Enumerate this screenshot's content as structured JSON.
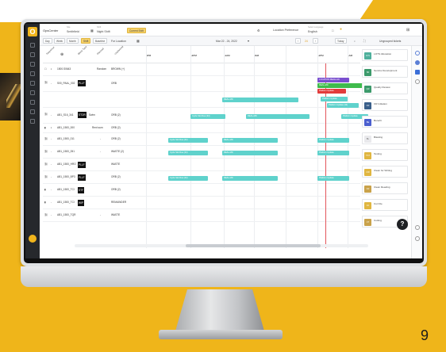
{
  "page_number": "9",
  "app": {
    "logo_letter": "O",
    "title": "OpsCenter",
    "selectors": [
      {
        "label": "Site",
        "value": "Smithfield"
      },
      {
        "label": "Shift",
        "value": "Night Shift"
      }
    ],
    "current_shift_button": "Current Shift",
    "location_preference": "Location Preference",
    "language_label": "Select Language",
    "language_value": "English"
  },
  "toolbar": {
    "view_buttons": [
      "Day",
      "Week",
      "Month",
      "Shift",
      "Baseline"
    ],
    "active_view": "Shift",
    "for_location": "For Location",
    "date_range": "Mar 22 - 24, 2022",
    "zoom": "24",
    "today_button": "Today",
    "ungrouped": "Ungrouped tickets"
  },
  "grid": {
    "column_titles": [
      "Sequence",
      "Block Type",
      "Planned",
      "Unplanned"
    ],
    "time_labels": [
      "9PM",
      "12PM",
      "11AM",
      "3AM",
      "11PM",
      "1AM"
    ],
    "rows": [
      {
        "id": "1500.S0643",
        "tag": "",
        "type": "Random",
        "value": "BROWN (+)"
      },
      {
        "id": "S00_PAAL_002",
        "tag": "PLLF",
        "type": "",
        "value": "ORB"
      },
      {
        "id": "",
        "tag": "",
        "type": "",
        "value": ""
      },
      {
        "id": "AB1_S16_341",
        "tag": "STOR",
        "type": "Swim",
        "value": "ORB (2)"
      },
      {
        "id": "AB1_1500_000",
        "tag": "",
        "type": "Rent sum",
        "value": "ORB (2)"
      },
      {
        "id": "AB1_1500_011",
        "tag": "",
        "type": "-",
        "value": "ORB (2)"
      },
      {
        "id": "AB1_1500_051",
        "tag": "",
        "type": "-",
        "value": "WASTE (2)"
      },
      {
        "id": "AB1_1500_HRO",
        "tag": "PLLF",
        "type": "",
        "value": "WASTE"
      },
      {
        "id": "AB1_1500_BP3",
        "tag": "PLLF",
        "type": "",
        "value": "ORB (2)"
      },
      {
        "id": "AB1_1500_TCI",
        "tag": "STF",
        "type": "",
        "value": "ORB (2)"
      },
      {
        "id": "AB1_1500_TCI",
        "tag": "WIP",
        "type": "",
        "value": "REMAINDER"
      },
      {
        "id": "AB1_1500_TQR",
        "tag": "",
        "type": "-",
        "value": "WASTE"
      }
    ],
    "bars": [
      {
        "label": "LOCATION REALLAN",
        "color": "purple"
      },
      {
        "label": "REAL-MD",
        "color": "green"
      },
      {
        "label": "Platform Update",
        "color": "red"
      },
      {
        "label": "REAL-MD",
        "color": "teal"
      },
      {
        "label": "Platform Update",
        "color": "teal"
      },
      {
        "label": "Platform Update (34)",
        "color": "teal"
      },
      {
        "label": "Cycle Slot Rea (34)",
        "color": "teal"
      },
      {
        "label": "REAL-MD",
        "color": "teal"
      },
      {
        "label": "Platform Update",
        "color": "teal"
      },
      {
        "label": "Cycle Slot Rea (34)",
        "color": "teal"
      },
      {
        "label": "REAL-MD",
        "color": "teal"
      },
      {
        "label": "Platform Update",
        "color": "teal"
      },
      {
        "label": "Cycle Slot Rea (34)",
        "color": "teal"
      },
      {
        "label": "REAL-MD",
        "color": "teal"
      },
      {
        "label": "Platform Update",
        "color": "teal"
      },
      {
        "label": "Cycle Slot Rea (34)",
        "color": "teal"
      },
      {
        "label": "REAL-MD",
        "color": "teal"
      },
      {
        "label": "Platform Update",
        "color": "teal"
      }
    ]
  },
  "legend": [
    {
      "code": "LFS",
      "label": "LOTS Allocation",
      "color": "#4fb09c"
    },
    {
      "code": "SD",
      "label": "Service Development",
      "color": "#3c9a6b"
    },
    {
      "code": "QR",
      "label": "Quality Review",
      "color": "#3c9a6b"
    },
    {
      "code": "CR",
      "label": "CR Initiation",
      "color": "#3a5f8a"
    },
    {
      "code": "BE",
      "label": "Benefit",
      "color": "#4b5fcf"
    },
    {
      "code": "BL",
      "label": "Blasting",
      "color": "#e9e9ec"
    },
    {
      "code": "TST",
      "label": "Testing",
      "color": "#e0b640"
    },
    {
      "code": "CW",
      "label": "Clean for Writing",
      "color": "#e0b640"
    },
    {
      "code": "CR",
      "label": "Clean Reading",
      "color": "#c9a24a"
    },
    {
      "code": "CF",
      "label": "Cut File",
      "color": "#e0b640"
    },
    {
      "code": "CT",
      "label": "Cutting",
      "color": "#c9a24a"
    }
  ],
  "help_label": "?"
}
